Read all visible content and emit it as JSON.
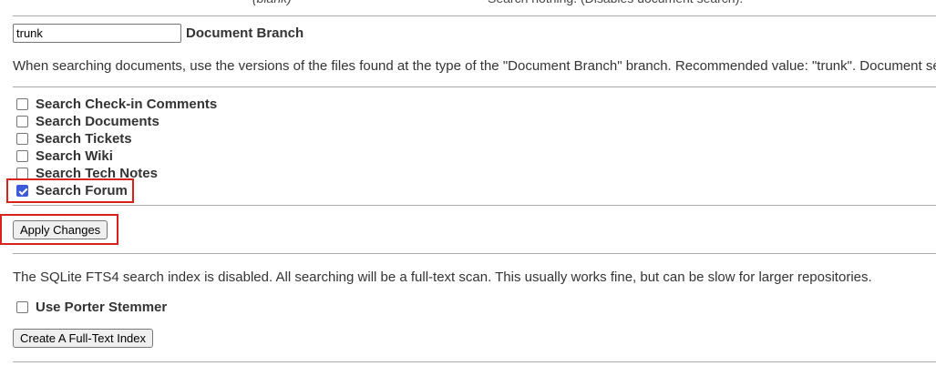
{
  "top_row": {
    "blank_label": "(blank)",
    "blank_desc": "Search nothing. (Disables document search)."
  },
  "doc_branch": {
    "value": "trunk",
    "label": "Document Branch",
    "description": "When searching documents, use the versions of the files found at the type of the \"Document Branch\" branch. Recommended value: \"trunk\". Document se"
  },
  "search_options": [
    {
      "label": "Search Check-in Comments",
      "checked": false
    },
    {
      "label": "Search Documents",
      "checked": false
    },
    {
      "label": "Search Tickets",
      "checked": false
    },
    {
      "label": "Search Wiki",
      "checked": false
    },
    {
      "label": "Search Tech Notes",
      "checked": false
    },
    {
      "label": "Search Forum",
      "checked": true
    }
  ],
  "apply_button": "Apply Changes",
  "fts": {
    "status_text": "The SQLite FTS4 search index is disabled. All searching will be a full-text scan. This usually works fine, but can be slow for larger repositories.",
    "porter_label": "Use Porter Stemmer",
    "porter_checked": false,
    "create_button": "Create A Full-Text Index"
  },
  "colors": {
    "highlight": "#d9221c",
    "checkbox_checked": "#3b5bdb"
  }
}
